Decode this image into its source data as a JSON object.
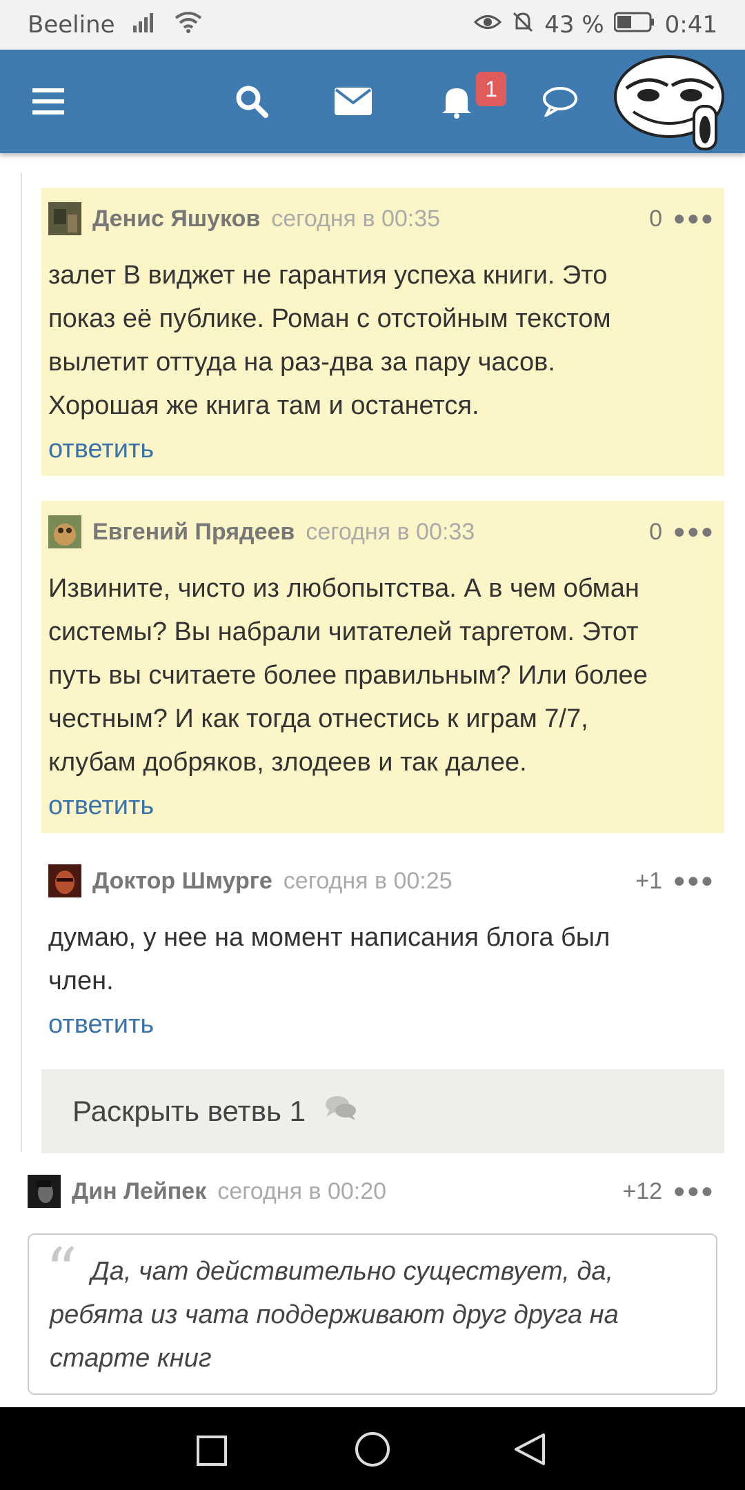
{
  "status_bar": {
    "carrier": "Beeline",
    "battery": "43 %",
    "time": "0:41"
  },
  "header": {
    "notification_count": "1",
    "icons": [
      "menu-icon",
      "search-icon",
      "mail-icon",
      "bell-icon",
      "chat-icon"
    ]
  },
  "colors": {
    "header_bg": "#3f7bb0",
    "highlight_bg": "#fcf5c7",
    "link": "#3a73aa",
    "badge": "#e05c5c"
  },
  "comments": [
    {
      "author": "Денис Яшуков",
      "time": "сегодня в 00:35",
      "score": "0",
      "lines": [
        "залет В виджет не гарантия успеха книги. Это",
        "показ её публике. Роман с отстойным текстом",
        "вылетит оттуда на раз-два за пару часов.",
        "Хорошая же книга там и останется."
      ],
      "reply": "ответить"
    },
    {
      "author": "Евгений Прядеев",
      "time": "сегодня в 00:33",
      "score": "0",
      "lines": [
        "Извините, чисто из любопытства. А в чем обман",
        "системы? Вы набрали читателей таргетом. Этот",
        "путь вы считаете более правильным? Или более",
        "честным? И как тогда отнестись к играм 7/7,",
        "клубам добряков, злодеев и так далее."
      ],
      "reply": "ответить"
    },
    {
      "author": "Доктор Шмурге",
      "time": "сегодня в 00:25",
      "score": "+1",
      "lines": [
        "думаю, у нее на момент написания блога был",
        "член."
      ],
      "reply": "ответить"
    },
    {
      "author": "Дин Лейпек",
      "time": "сегодня в 00:20",
      "score": "+12"
    }
  ],
  "expand_thread": "Раскрыть ветвь 1",
  "quote": {
    "lines": [
      "Да, чат действительно существует, да,",
      "ребята из чата поддерживают друг друга на",
      "старте книг"
    ]
  }
}
